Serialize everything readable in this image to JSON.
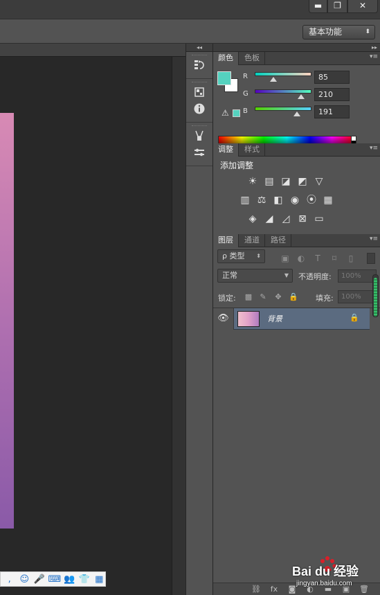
{
  "window": {
    "minimize_glyph": "▬",
    "maximize_glyph": "❐",
    "close_glyph": "✕"
  },
  "options_bar": {
    "workspace": "基本功能",
    "workspace_caret": "⬍"
  },
  "dock": {
    "collapse_glyph": "◂◂",
    "icons": [
      "history-icon",
      "properties-icon",
      "info-icon",
      "brush-icon",
      "brush-presets-icon"
    ]
  },
  "panels": {
    "collapse_glyph": "▸▸",
    "menu_glyph": "▾≡"
  },
  "color_panel": {
    "tabs": [
      "颜色",
      "色板"
    ],
    "active_tab": 0,
    "channels": [
      {
        "label": "R",
        "value": "85",
        "fraction": 0.33
      },
      {
        "label": "G",
        "value": "210",
        "fraction": 0.82
      },
      {
        "label": "B",
        "value": "191",
        "fraction": 0.75
      }
    ],
    "foreground_color": "#55d2bf",
    "background_color": "#ffffff",
    "warning_glyph": "⚠"
  },
  "adjustments_panel": {
    "tabs": [
      "调整",
      "样式"
    ],
    "active_tab": 0,
    "title": "添加调整",
    "rows": [
      [
        "☀",
        "▤",
        "◪",
        "◩",
        "▽"
      ],
      [
        "▥",
        "⚖",
        "◧",
        "◉",
        "⦿",
        "▦"
      ],
      [
        "◈",
        "◢",
        "◿",
        "⊠",
        "▭"
      ]
    ]
  },
  "layers_panel": {
    "tabs": [
      "图层",
      "通道",
      "路径"
    ],
    "active_tab": 0,
    "filter_label": "ρ 类型",
    "filter_icons": [
      "▣",
      "◐",
      "T",
      "⌑",
      "▯"
    ],
    "blend_mode": "正常",
    "opacity_label": "不透明度:",
    "opacity_value": "100%",
    "lock_label": "锁定:",
    "lock_icons": [
      "▩",
      "✎",
      "✥",
      "🔒"
    ],
    "fill_label": "填充:",
    "fill_value": "100%",
    "layers": [
      {
        "name": "背景",
        "visible": true,
        "locked": true
      }
    ],
    "eye_glyph": "👁",
    "layer_lock_glyph": "🔒",
    "footer_icons": [
      "⛓",
      "fx",
      "◙",
      "◐",
      "▬",
      "▣",
      "🗑"
    ]
  },
  "ime_bar": {
    "icons": [
      ",",
      "☺",
      "🎤",
      "⌨",
      "👥",
      "👕",
      "▦"
    ]
  },
  "watermark": {
    "brand": "Bai du 经验",
    "url": "jingyan.baidu.com"
  }
}
